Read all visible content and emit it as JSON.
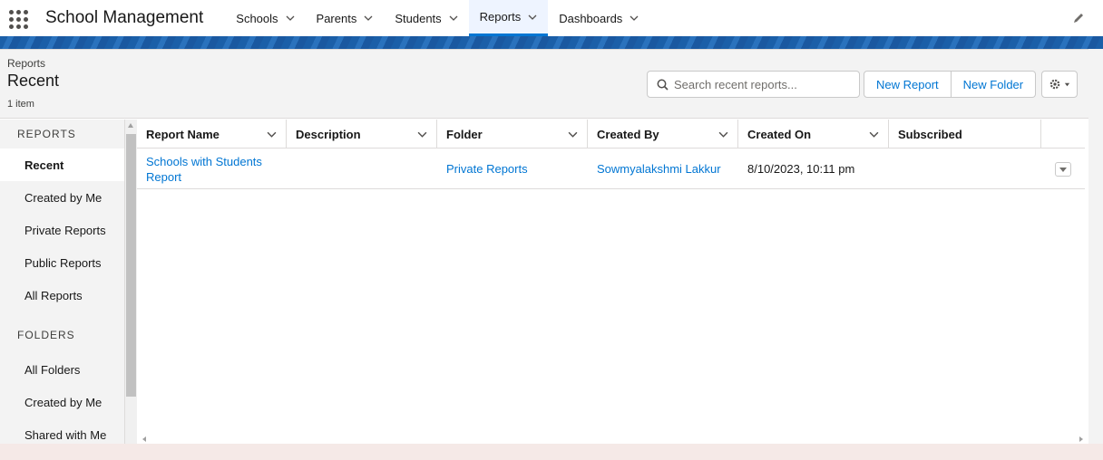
{
  "app": {
    "name": "School Management"
  },
  "nav": {
    "items": [
      {
        "label": "Schools"
      },
      {
        "label": "Parents"
      },
      {
        "label": "Students"
      },
      {
        "label": "Reports"
      },
      {
        "label": "Dashboards"
      }
    ],
    "active": "Reports"
  },
  "header": {
    "eyebrow": "Reports",
    "title": "Recent",
    "count": "1 item",
    "search_placeholder": "Search recent reports...",
    "new_report": "New Report",
    "new_folder": "New Folder"
  },
  "sidebar": {
    "reports_heading": "REPORTS",
    "reports_items": [
      {
        "label": "Recent"
      },
      {
        "label": "Created by Me"
      },
      {
        "label": "Private Reports"
      },
      {
        "label": "Public Reports"
      },
      {
        "label": "All Reports"
      }
    ],
    "folders_heading": "FOLDERS",
    "folders_items": [
      {
        "label": "All Folders"
      },
      {
        "label": "Created by Me"
      },
      {
        "label": "Shared with Me"
      }
    ],
    "active": "Recent"
  },
  "table": {
    "columns": [
      "Report Name",
      "Description",
      "Folder",
      "Created By",
      "Created On",
      "Subscribed"
    ],
    "rows": [
      {
        "report_name": "Schools with Students Report",
        "description": "",
        "folder": "Private Reports",
        "created_by": "Sowmyalakshmi Lakkur",
        "created_on": "8/10/2023, 10:11 pm",
        "subscribed": ""
      }
    ]
  },
  "colors": {
    "accent": "#0176d3",
    "banner": "#1b5fa8",
    "panel": "#f3f3f3"
  }
}
